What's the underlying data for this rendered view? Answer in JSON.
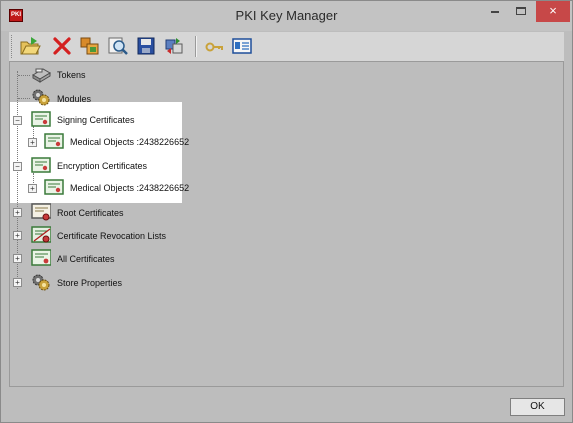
{
  "window": {
    "title": "PKI Key Manager",
    "close_glyph": "×",
    "icon_text": "PKI"
  },
  "toolbar": {
    "buttons": [
      {
        "name": "open-icon"
      },
      {
        "name": "delete-icon"
      },
      {
        "name": "import-icon"
      },
      {
        "name": "inspect-icon"
      },
      {
        "name": "save-icon"
      },
      {
        "name": "transfer-icon"
      },
      {
        "name": "key-icon"
      },
      {
        "name": "properties-icon"
      }
    ]
  },
  "tree": {
    "items": [
      {
        "label": "Tokens"
      },
      {
        "label": "Modules"
      },
      {
        "label": "Signing Certificates",
        "expander": "−"
      },
      {
        "label": "Medical Objects :2438226652",
        "expander": "+"
      },
      {
        "label": "Encryption Certificates",
        "expander": "−"
      },
      {
        "label": "Medical Objects :2438226652",
        "expander": "+"
      },
      {
        "label": "Root Certificates",
        "expander": "+"
      },
      {
        "label": "Certificate Revocation Lists",
        "expander": "+"
      },
      {
        "label": "All Certificates",
        "expander": "+"
      },
      {
        "label": "Store Properties",
        "expander": "+"
      }
    ]
  },
  "footer": {
    "ok_label": "OK"
  }
}
